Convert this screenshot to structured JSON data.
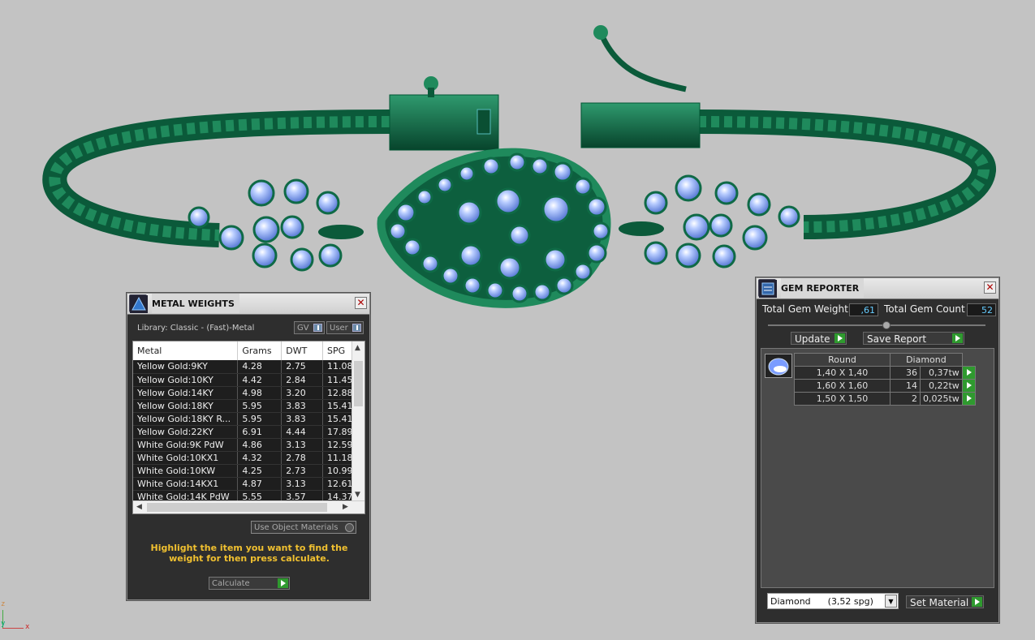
{
  "metal_weights": {
    "title": "METAL WEIGHTS",
    "library": "Library: Classic - (Fast)-Metal",
    "btn_gv": "GV",
    "btn_user": "User",
    "columns": [
      "Metal",
      "Grams",
      "DWT",
      "SPG"
    ],
    "rows": [
      {
        "metal": "Yellow Gold:9KY",
        "grams": "4.28",
        "dwt": "2.75",
        "spg": "11.08"
      },
      {
        "metal": "Yellow Gold:10KY",
        "grams": "4.42",
        "dwt": "2.84",
        "spg": "11.45"
      },
      {
        "metal": "Yellow Gold:14KY",
        "grams": "4.98",
        "dwt": "3.20",
        "spg": "12.88"
      },
      {
        "metal": "Yellow Gold:18KY",
        "grams": "5.95",
        "dwt": "3.83",
        "spg": "15.41"
      },
      {
        "metal": "Yellow Gold:18KY R...",
        "grams": "5.95",
        "dwt": "3.83",
        "spg": "15.41"
      },
      {
        "metal": "Yellow Gold:22KY",
        "grams": "6.91",
        "dwt": "4.44",
        "spg": "17.89"
      },
      {
        "metal": "White Gold:9K PdW",
        "grams": "4.86",
        "dwt": "3.13",
        "spg": "12.59"
      },
      {
        "metal": "White Gold:10KX1",
        "grams": "4.32",
        "dwt": "2.78",
        "spg": "11.18"
      },
      {
        "metal": "White Gold:10KW",
        "grams": "4.25",
        "dwt": "2.73",
        "spg": "10.99"
      },
      {
        "metal": "White Gold:14KX1",
        "grams": "4.87",
        "dwt": "3.13",
        "spg": "12.61"
      },
      {
        "metal": "White Gold:14K PdW",
        "grams": "5.55",
        "dwt": "3.57",
        "spg": "14.37"
      }
    ],
    "use_object_materials": "Use Object Materials",
    "hint": "Highlight the item you want to find the weight for then press calculate.",
    "calculate": "Calculate"
  },
  "gem_reporter": {
    "title": "GEM REPORTER",
    "total_weight_label": "Total Gem Weight",
    "total_weight_value": ",61",
    "total_count_label": "Total Gem Count",
    "total_count_value": "52",
    "update": "Update",
    "save_report": "Save Report",
    "shape": "Round",
    "stone": "Diamond",
    "gems": [
      {
        "size": "1,40 X 1,40",
        "count": "36",
        "weight": "0,37tw"
      },
      {
        "size": "1,60 X 1,60",
        "count": "14",
        "weight": "0,22tw"
      },
      {
        "size": "1,50 X 1,50",
        "count": "2",
        "weight": "0,025tw"
      }
    ],
    "material_select": "Diamond      (3,52 spg)",
    "set_material": "Set Material"
  },
  "axis": {
    "z": "z",
    "y": "y",
    "x": "x"
  },
  "colors": {
    "metal": "#0f6a46",
    "gem": "#8fb3ff",
    "background": "#c3c3c3"
  }
}
